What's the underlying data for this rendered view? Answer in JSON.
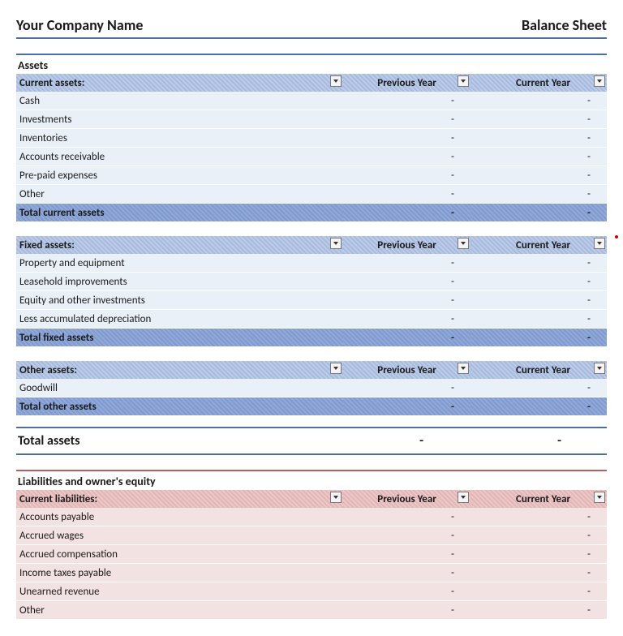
{
  "header": {
    "company": "Your Company Name",
    "title": "Balance Sheet"
  },
  "col": {
    "prev": "Previous Year",
    "curr": "Current Year"
  },
  "dash": "-",
  "assets": {
    "title": "Assets",
    "current": {
      "heading": "Current assets:",
      "rows": [
        "Cash",
        "Investments",
        "Inventories",
        "Accounts receivable",
        "Pre-paid expenses",
        "Other"
      ],
      "total": "Total current assets"
    },
    "fixed": {
      "heading": "Fixed assets:",
      "rows": [
        "Property and equipment",
        "Leasehold improvements",
        "Equity and other investments",
        "Less accumulated depreciation"
      ],
      "total": "Total fixed assets"
    },
    "other": {
      "heading": "Other assets:",
      "rows": [
        "Goodwill"
      ],
      "total": "Total other assets"
    },
    "grand": "Total assets"
  },
  "liab": {
    "title": "Liabilities and owner's equity",
    "current": {
      "heading": "Current liabilities:",
      "rows": [
        "Accounts payable",
        "Accrued wages",
        "Accrued compensation",
        "Income taxes payable",
        "Unearned revenue",
        "Other"
      ]
    }
  }
}
